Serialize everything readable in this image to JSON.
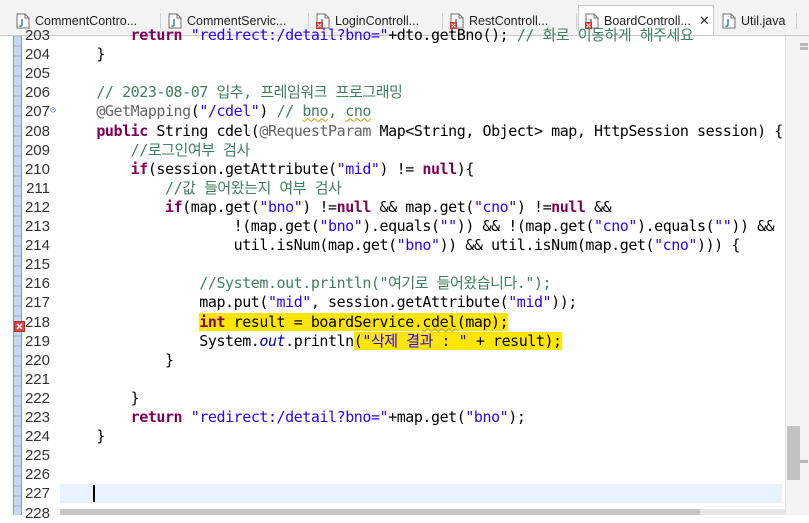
{
  "tabs": [
    {
      "label": "CommentContro...",
      "type": "java"
    },
    {
      "label": "CommentServic...",
      "type": "java"
    },
    {
      "label": "LoginControll...",
      "type": "java-error"
    },
    {
      "label": "RestControll...",
      "type": "java-error"
    },
    {
      "label": "BoardControll...",
      "type": "java-error",
      "active": true,
      "close": "✕"
    },
    {
      "label": "Util.java",
      "type": "java"
    }
  ],
  "lines": [
    {
      "n": "203",
      "html": "        <span class=\"kw\">return</span> <span class=\"str\">\"redirect:/detail?bno=\"</span>+dto.getBno(); <span class=\"cm\">// 화로 이동하게 해주세요</span>"
    },
    {
      "n": "204",
      "html": "    }"
    },
    {
      "n": "205",
      "html": ""
    },
    {
      "n": "206",
      "html": "    <span class=\"cm\">// 2023-08-07 입추, 프레임워크 프로그래밍</span>"
    },
    {
      "n": "207",
      "html": "    <span class=\"ann\">@GetMapping</span>(<span class=\"str\">\"/cdel\"</span>) <span class=\"cm\">// <span class=\"wave\">bno</span>, <span class=\"wave\">cno</span></span>",
      "fold": true
    },
    {
      "n": "208",
      "html": "    <span class=\"kw\">public</span> String cdel(<span class=\"ann\">@RequestParam</span> Map&lt;String, Object&gt; map, HttpSession session) {"
    },
    {
      "n": "209",
      "html": "        <span class=\"cm\">//로그인여부 검사</span>"
    },
    {
      "n": "210",
      "html": "        <span class=\"kw\">if</span>(session.getAttribute(<span class=\"str\">\"mid\"</span>) != <span class=\"kw\">null</span>){"
    },
    {
      "n": "211",
      "html": "            <span class=\"cm\">//값 들어왔는지 여부 검사</span>"
    },
    {
      "n": "212",
      "html": "            <span class=\"kw\">if</span>(map.get(<span class=\"str\">\"bno\"</span>) !=<span class=\"kw\">null</span> &amp;&amp; map.get(<span class=\"str\">\"cno\"</span>) !=<span class=\"kw\">null</span> &amp;&amp;"
    },
    {
      "n": "213",
      "html": "                    !(map.get(<span class=\"str\">\"bno\"</span>).equals(<span class=\"str\">\"\"</span>)) &amp;&amp; !(map.get(<span class=\"str\">\"cno\"</span>).equals(<span class=\"str\">\"\"</span>)) &amp;&amp;"
    },
    {
      "n": "214",
      "html": "                    util.isNum(map.get(<span class=\"str\">\"bno\"</span>)) &amp;&amp; util.isNum(map.get(<span class=\"str\">\"cno\"</span>))) {"
    },
    {
      "n": "215",
      "html": ""
    },
    {
      "n": "216",
      "html": "                <span class=\"cm\">//System.out.println(\"여기로 들어왔습니다.\");</span>"
    },
    {
      "n": "217",
      "html": "                map.put(<span class=\"str\">\"mid\"</span>, session.getAttribute(<span class=\"str\">\"mid\"</span>));"
    },
    {
      "n": "218",
      "html": "                <span class=\"hl\"><span class=\"kw\">int</span> result = boardService.<span class=\"wave\">cdel</span>(map);</span>",
      "error": true
    },
    {
      "n": "219",
      "html": "                System.<span class=\"fld\">out</span>.println<span class=\"hl\">(<span class=\"str\">\"삭제 결과 : \"</span> + result);</span>"
    },
    {
      "n": "220",
      "html": "            }"
    },
    {
      "n": "221",
      "html": ""
    },
    {
      "n": "222",
      "html": "        }"
    },
    {
      "n": "223",
      "html": "        <span class=\"kw\">return</span> <span class=\"str\">\"redirect:/detail?bno=\"</span>+map.get(<span class=\"str\">\"bno\"</span>);"
    },
    {
      "n": "224",
      "html": "    }"
    },
    {
      "n": "225",
      "html": ""
    },
    {
      "n": "226",
      "html": ""
    },
    {
      "n": "227",
      "html": "",
      "current": true
    },
    {
      "n": "228",
      "html": ""
    }
  ]
}
